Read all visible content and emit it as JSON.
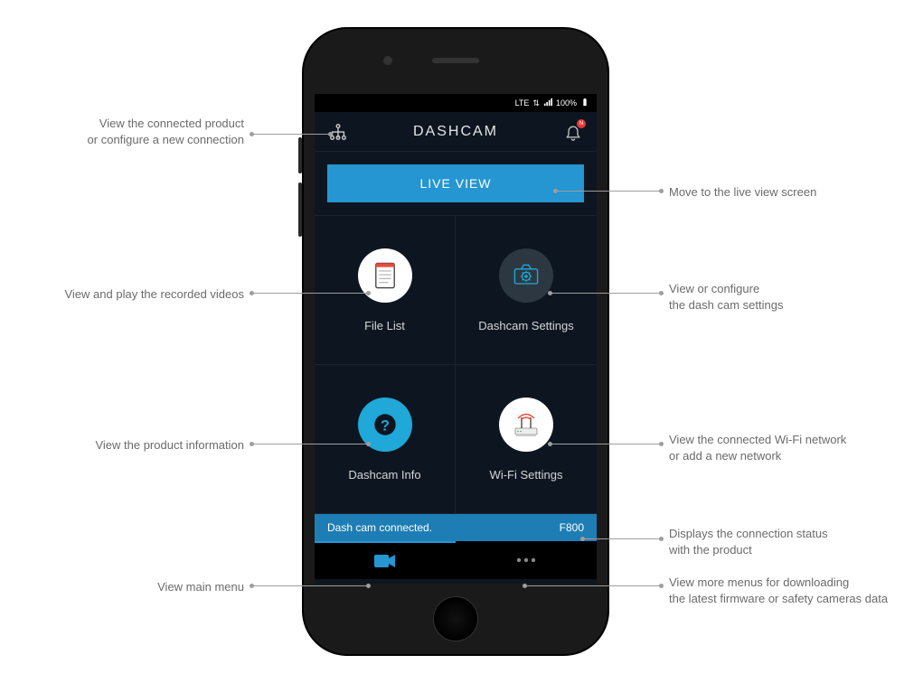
{
  "status_bar": {
    "lte": "LTE",
    "signal_icon": "signal",
    "battery_pct": "100%"
  },
  "header": {
    "network_icon": "network-icon",
    "title": "DASHCAM",
    "notif_icon": "bell-icon",
    "notif_badge": "N"
  },
  "live_view": {
    "label": "LIVE VIEW"
  },
  "tiles": [
    {
      "label": "File List"
    },
    {
      "label": "Dashcam Settings"
    },
    {
      "label": "Dashcam Info"
    },
    {
      "label": "Wi-Fi Settings"
    }
  ],
  "status_strip": {
    "text": "Dash cam connected.",
    "model": "F800"
  },
  "bottom_nav": {
    "main_icon": "camera-icon",
    "more_icon": "more-icon"
  },
  "callouts": {
    "connected_product": "View the connected product\nor configure a new connection",
    "live_view": "Move to the live view screen",
    "file_list": "View and play the recorded videos",
    "dashcam_settings": "View or configure\nthe dash cam settings",
    "dashcam_info": "View the product information",
    "wifi_settings": "View the connected Wi-Fi network\nor add a new network",
    "status": "Displays the connection status\nwith the product",
    "main_menu": "View main menu",
    "more_menu": "View more menus for downloading\nthe latest firmware or safety cameras data"
  }
}
